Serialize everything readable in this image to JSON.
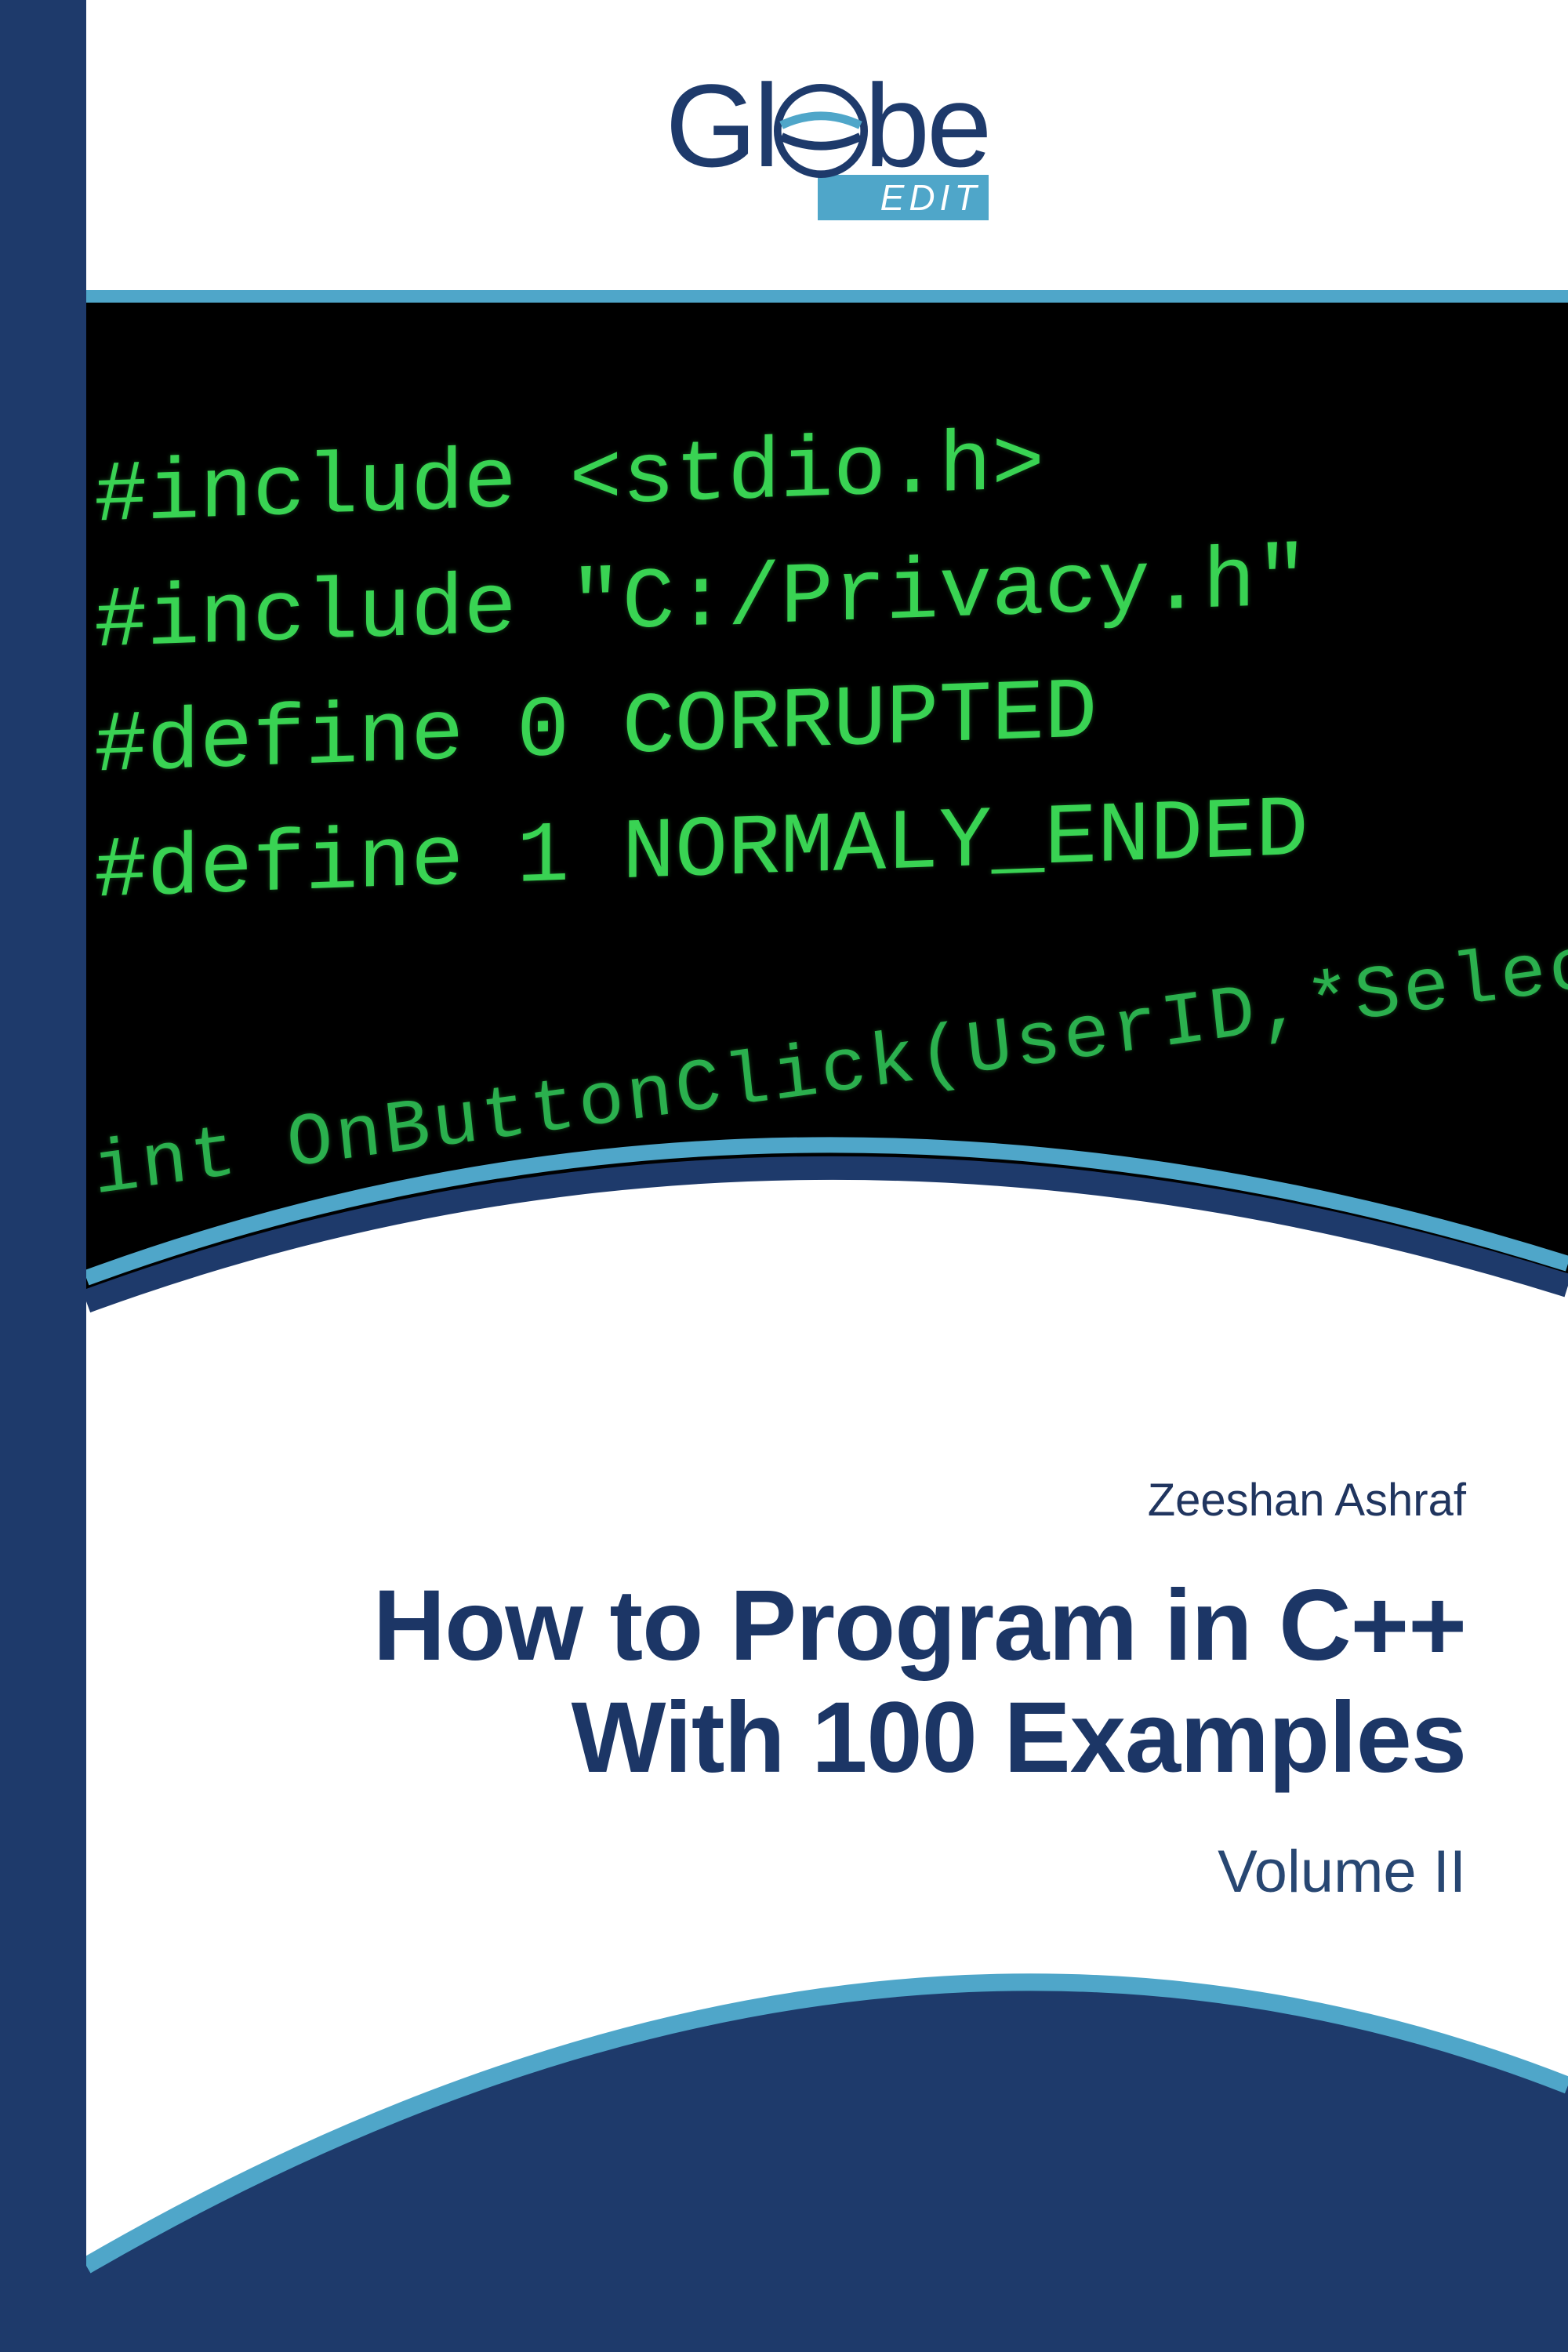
{
  "publisher": {
    "name_left": "Gl",
    "name_right": "be",
    "sub": "EDIT"
  },
  "code": {
    "line1": "#include <stdio.h>",
    "line2": "#include \"C:/Privacy.h\"",
    "line3": "#define 0 CORRUPTED",
    "line4": "#define 1 NORMALY_ENDED",
    "line5": "int OnButtonClick(UserID,*Select"
  },
  "author": "Zeeshan Ashraf",
  "title_line1": "How to Program in C++",
  "title_line2": "With 100 Examples",
  "subtitle": "Volume II",
  "colors": {
    "navy": "#1e3a6b",
    "accent": "#4fa6c9",
    "code_green": "#39d353"
  }
}
